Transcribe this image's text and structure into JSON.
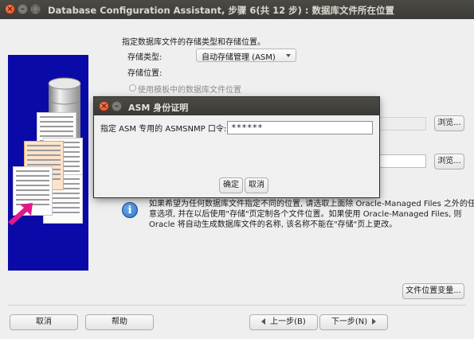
{
  "window": {
    "title": "Database Configuration Assistant, 步骤 6(共 12 步) : 数据库文件所在位置"
  },
  "heading": "指定数据库文件的存储类型和存储位置。",
  "storage_type": {
    "label": "存储类型:",
    "value": "自动存储管理 (ASM)"
  },
  "storage_location": {
    "label": "存储位置:",
    "radio_template": "使用模板中的数据库文件位置"
  },
  "browse_label": "浏览...",
  "info_text": [
    "如果希望为任何数据库文件指定不同的位置, 请选取上面除 Oracle-Managed Files 之外的任",
    "意选项, 并在以后使用\"存储\"页定制各个文件位置。如果使用 Oracle-Managed Files, 则",
    "Oracle 将自动生成数据库文件的名称, 该名称不能在\"存储\"页上更改。"
  ],
  "file_locations_button": "文件位置变量...",
  "footer": {
    "cancel": "取消",
    "help": "帮助",
    "back": "上一步(B)",
    "next": "下一步(N)"
  },
  "dialog": {
    "title": "ASM 身份证明",
    "label": "指定 ASM 专用的 ASMSNMP 口令:",
    "password_value": "******",
    "ok": "确定",
    "cancel": "取消"
  },
  "colors": {
    "illustration_bg": "#0a0aa8",
    "arrow": "#e0198a",
    "titlebar": "#3c3b37",
    "close_button": "#e0491f"
  },
  "icons": [
    "close-icon",
    "minimize-icon",
    "maximize-icon",
    "info-icon",
    "chevron-down-icon",
    "back-arrow-icon",
    "next-arrow-icon"
  ]
}
